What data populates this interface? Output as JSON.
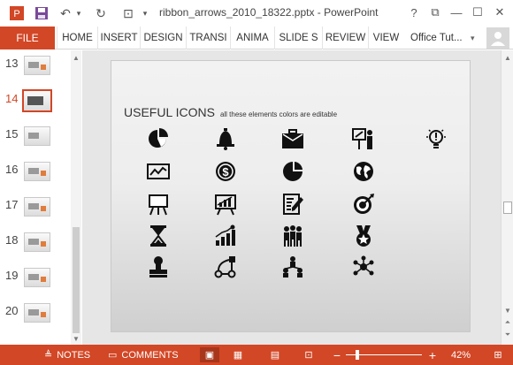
{
  "window": {
    "title": "ribbon_arrows_2010_18322.pptx - PowerPoint",
    "help": "?",
    "restore_ribbon": "⧉",
    "minimize": "—",
    "maximize": "☐",
    "close": "✕"
  },
  "qat": {
    "save": "💾",
    "undo": "↶",
    "undo_drop": "▾",
    "redo": "↻",
    "present": "⊡",
    "customize": "▾"
  },
  "ribbon": {
    "file_label": "FILE",
    "tabs": [
      "HOME",
      "INSERT",
      "DESIGN",
      "TRANSI",
      "ANIMA",
      "SLIDE S",
      "REVIEW",
      "VIEW"
    ],
    "account": "Office Tut...",
    "account_arrow": "▾"
  },
  "thumbnails": [
    {
      "num": "13",
      "active": false
    },
    {
      "num": "14",
      "active": true
    },
    {
      "num": "15",
      "active": false
    },
    {
      "num": "16",
      "active": false
    },
    {
      "num": "17",
      "active": false
    },
    {
      "num": "18",
      "active": false
    },
    {
      "num": "19",
      "active": false
    },
    {
      "num": "20",
      "active": false
    }
  ],
  "slide": {
    "title": "USEFUL ICONS",
    "subtitle": "all these elements colors are editable",
    "icons": [
      "pie-chart",
      "bell",
      "briefcase",
      "presenter",
      "lightbulb",
      "line-chart",
      "dollar-coin",
      "pie-slice",
      "globe",
      "easel",
      "easel-chart",
      "document-edit",
      "target",
      "hourglass",
      "growth-bars",
      "team",
      "award",
      "stamp",
      "workflow",
      "network-people",
      "hub"
    ]
  },
  "statusbar": {
    "notes_icon": "≜",
    "notes": "NOTES",
    "comments_icon": "▭",
    "comments": "COMMENTS",
    "view_normal": "▣",
    "view_sorter": "▦",
    "view_reading": "▤",
    "view_slideshow": "⊡",
    "zoom_out": "−",
    "zoom_in": "+",
    "zoom": "42%",
    "fit": "⊞"
  },
  "colors": {
    "accent": "#d24726",
    "icon": "#111111"
  }
}
